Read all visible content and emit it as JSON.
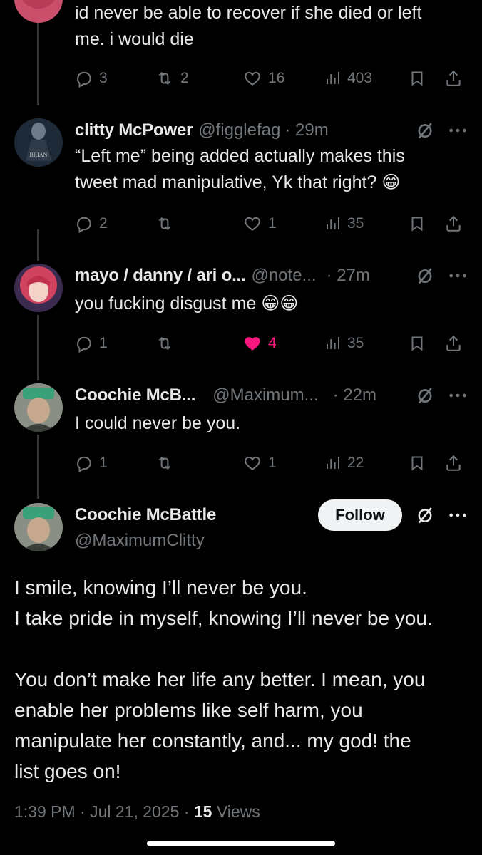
{
  "partial_tweet": {
    "text_line1": "id never be able to recover if she died or left",
    "text_line2": "me. i would die",
    "replies": "3",
    "reposts": "2",
    "likes": "16",
    "views": "403"
  },
  "replies": [
    {
      "name": "clitty McPower",
      "handle": "@figglefag",
      "time": "· 29m",
      "avatar_label": "BRIAN",
      "text_line1": "“Left me” being added actually makes this",
      "text_line2": "tweet mad manipulative, Yk that right? 😁",
      "replies": "2",
      "reposts": "",
      "likes": "1",
      "views": "35",
      "liked": false
    },
    {
      "name": "mayo / danny / ari o...",
      "handle": "@note...",
      "time": "· 27m",
      "text_line1": "you fucking disgust me 😁😁",
      "replies": "1",
      "reposts": "",
      "likes": "4",
      "views": "35",
      "liked": true
    },
    {
      "name": "Coochie McB...",
      "handle": "@Maximum...",
      "time": "· 22m",
      "text_line1": "I could never be you.",
      "replies": "1",
      "reposts": "",
      "likes": "1",
      "views": "22",
      "liked": false
    }
  ],
  "main_tweet": {
    "name": "Coochie McBattle",
    "handle": "@MaximumClitty",
    "follow_label": "Follow",
    "paragraph1_line1": "I smile, knowing I’ll never be you.",
    "paragraph1_line2": "I take pride in myself, knowing I’ll never be you.",
    "paragraph2_line1": "You don’t make her life any better. I mean, you",
    "paragraph2_line2": "enable her problems like self harm, you",
    "paragraph2_line3": "manipulate her constantly, and... my god! the",
    "paragraph2_line4": "list goes on!",
    "timestamp": "1:39 PM · Jul 21, 2025 · ",
    "views_count": "15",
    "views_label": " Views"
  },
  "icons": {
    "reply": "reply-icon",
    "repost": "repost-icon",
    "like": "heart-icon",
    "views": "views-icon",
    "bookmark": "bookmark-icon",
    "share": "share-icon",
    "grok": "grok-icon",
    "more": "more-icon"
  },
  "colors": {
    "background": "#000000",
    "text": "#e7e9ea",
    "muted": "#71767b",
    "like_active": "#f91880",
    "thread_line": "#333639"
  }
}
